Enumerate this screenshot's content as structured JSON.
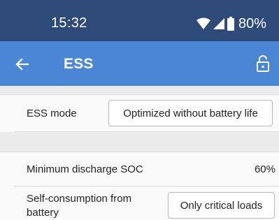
{
  "status_bar": {
    "time": "15:32",
    "battery_percent": "80%",
    "icons": [
      "wifi-icon",
      "cell-signal-icon",
      "battery-icon"
    ]
  },
  "app_bar": {
    "back_icon": "arrow-left-icon",
    "title": "ESS",
    "lock_icon": "lock-icon"
  },
  "settings": {
    "ess_mode": {
      "label": "ESS mode",
      "value": "Optimized without battery life"
    },
    "min_discharge_soc": {
      "label": "Minimum discharge SOC",
      "value": "60%"
    },
    "self_consumption": {
      "label_line1": "Self-consumption from",
      "label_line2": "battery",
      "value": "Only critical loads"
    }
  },
  "colors": {
    "status_bar": "#2e4a78",
    "app_bar": "#4a86d4",
    "background": "#fafafa",
    "separator": "#ececec"
  }
}
